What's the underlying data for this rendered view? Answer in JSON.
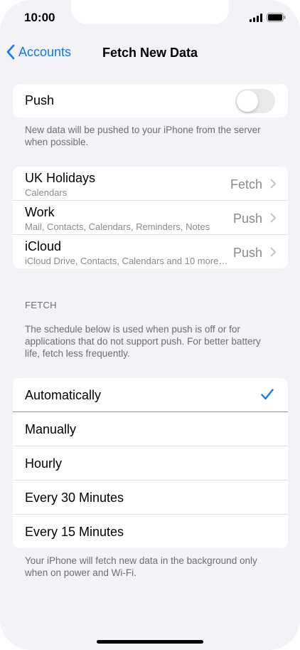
{
  "status": {
    "time": "10:00"
  },
  "nav": {
    "back_label": "Accounts",
    "title": "Fetch New Data"
  },
  "push": {
    "label": "Push",
    "enabled": false,
    "footnote": "New data will be pushed to your iPhone from the server when possible."
  },
  "accounts": [
    {
      "name": "UK Holidays",
      "detail": "Calendars",
      "value": "Fetch"
    },
    {
      "name": "Work",
      "detail": "Mail, Contacts, Calendars, Reminders, Notes",
      "value": "Push"
    },
    {
      "name": "iCloud",
      "detail": "iCloud Drive, Contacts, Calendars and 10 more…",
      "value": "Push"
    }
  ],
  "fetch": {
    "header": "FETCH",
    "description": "The schedule below is used when push is off or for applications that do not support push. For better battery life, fetch less frequently.",
    "options": [
      {
        "label": "Automatically",
        "selected": true
      },
      {
        "label": "Manually",
        "selected": false
      },
      {
        "label": "Hourly",
        "selected": false
      },
      {
        "label": "Every 30 Minutes",
        "selected": false
      },
      {
        "label": "Every 15 Minutes",
        "selected": false
      }
    ],
    "footnote": "Your iPhone will fetch new data in the background only when on power and Wi-Fi."
  },
  "colors": {
    "accent": "#0a7aff",
    "background": "#f2f2f7"
  }
}
